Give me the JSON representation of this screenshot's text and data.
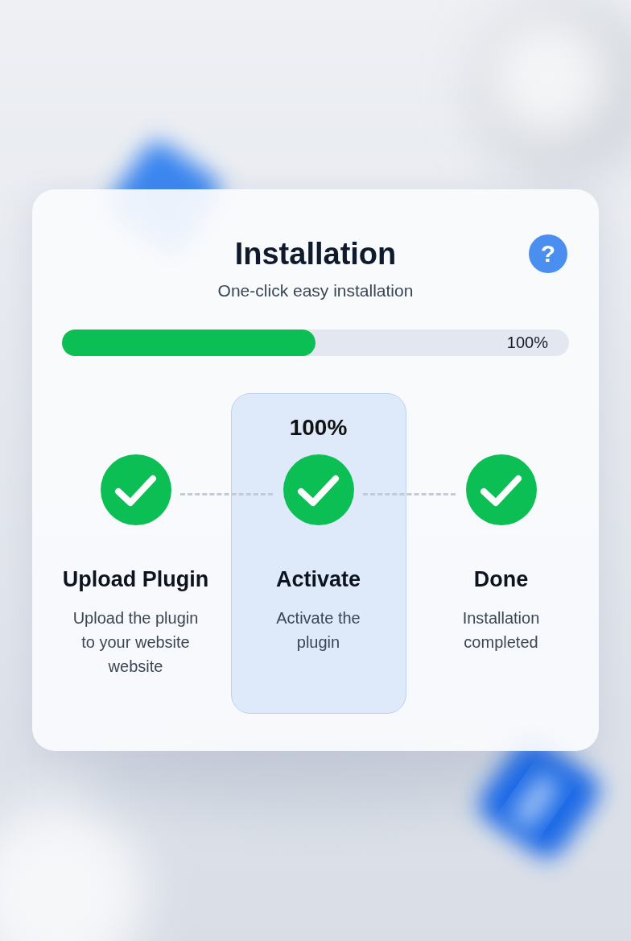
{
  "title": "Installation",
  "help": "?",
  "subtitle": "One-click easy installation",
  "progress": {
    "level": 0.5,
    "reading": "100%"
  },
  "steps": [
    {
      "title": "Upload Plugin",
      "description": "Upload the plugin to your website website",
      "completed": true,
      "selected": false
    },
    {
      "title": "Activate",
      "description": "Activate the plugin",
      "completed": true,
      "selected": true,
      "percent": "100%"
    },
    {
      "title": "Done",
      "description": "Installation completed",
      "completed": true,
      "selected": false
    }
  ]
}
